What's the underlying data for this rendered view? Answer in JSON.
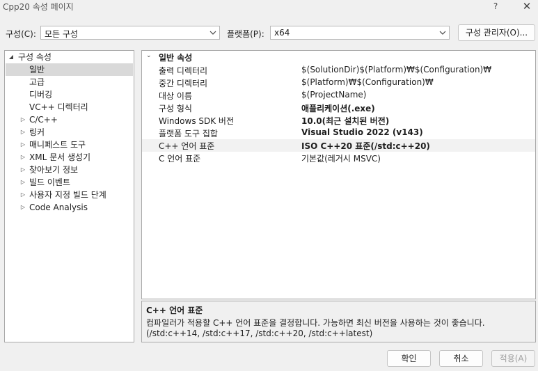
{
  "window": {
    "title": "Cpp20 속성 페이지",
    "help_glyph": "?",
    "close_glyph": "✕"
  },
  "toolbar": {
    "config_label": "구성(C):",
    "config_value": "모든 구성",
    "platform_label": "플랫폼(P):",
    "platform_value": "x64",
    "config_manager_label": "구성 관리자(O)..."
  },
  "tree": {
    "root_label": "구성 속성",
    "items": [
      {
        "label": "일반",
        "has_children": false,
        "selected": true
      },
      {
        "label": "고급",
        "has_children": false
      },
      {
        "label": "디버깅",
        "has_children": false
      },
      {
        "label": "VC++ 디렉터리",
        "has_children": false
      },
      {
        "label": "C/C++",
        "has_children": true
      },
      {
        "label": "링커",
        "has_children": true
      },
      {
        "label": "매니페스트 도구",
        "has_children": true
      },
      {
        "label": "XML 문서 생성기",
        "has_children": true
      },
      {
        "label": "찾아보기 정보",
        "has_children": true
      },
      {
        "label": "빌드 이벤트",
        "has_children": true
      },
      {
        "label": "사용자 지정 빌드 단계",
        "has_children": true
      },
      {
        "label": "Code Analysis",
        "has_children": true
      }
    ]
  },
  "grid": {
    "section_label": "일반 속성",
    "rows": [
      {
        "name": "출력 디렉터리",
        "value": "$(SolutionDir)$(Platform)₩$(Configuration)₩",
        "bold": false
      },
      {
        "name": "중간 디렉터리",
        "value": "$(Platform)₩$(Configuration)₩",
        "bold": false
      },
      {
        "name": "대상 이름",
        "value": "$(ProjectName)",
        "bold": false
      },
      {
        "name": "구성 형식",
        "value": "애플리케이션(.exe)",
        "bold": true
      },
      {
        "name": "Windows SDK 버전",
        "value": "10.0(최근 설치된 버전)",
        "bold": true
      },
      {
        "name": "플랫폼 도구 집합",
        "value": "Visual Studio 2022 (v143)",
        "bold": true
      },
      {
        "name": "C++ 언어 표준",
        "value": "ISO C++20 표준(/std:c++20)",
        "bold": true,
        "selected": true
      },
      {
        "name": "C 언어 표준",
        "value": "기본값(레거시 MSVC)",
        "bold": false
      }
    ]
  },
  "description": {
    "title": "C++ 언어 표준",
    "line1": "컴파일러가 적용할 C++ 언어 표준을 결정합니다. 가능하면 최신 버전을 사용하는 것이 좋습니다.",
    "line2": "(/std:c++14, /std:c++17, /std:c++20, /std:c++latest)"
  },
  "footer": {
    "ok_label": "확인",
    "cancel_label": "취소",
    "apply_label": "적용(A)"
  },
  "colors": {
    "selected_tree_bg": "#d9d9d9",
    "selected_row_bg": "#f2f2f2",
    "disabled_text": "#a0a0a0"
  }
}
